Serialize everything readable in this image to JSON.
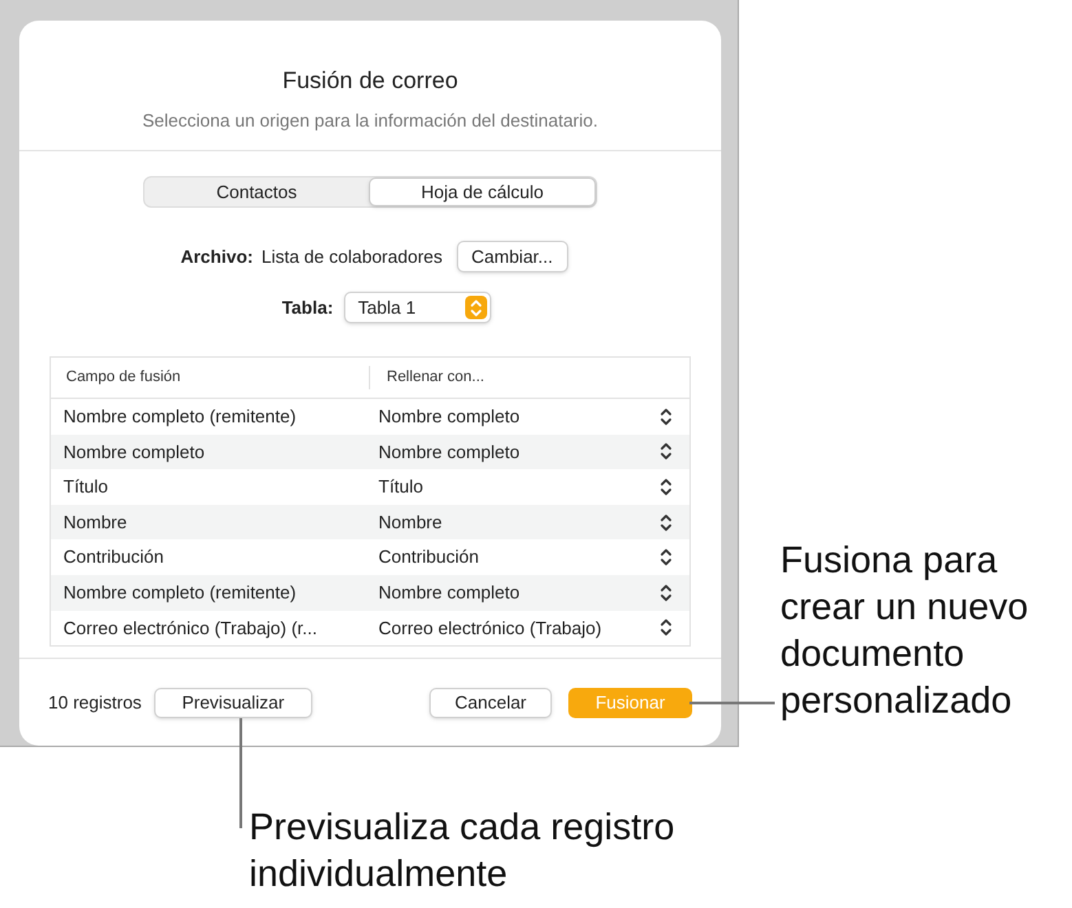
{
  "dialog": {
    "title": "Fusión de correo",
    "subtitle": "Selecciona un origen para la información del destinatario."
  },
  "source_tabs": [
    {
      "label": "Contactos",
      "selected": false
    },
    {
      "label": "Hoja de cálculo",
      "selected": true
    }
  ],
  "file": {
    "label": "Archivo:",
    "value": "Lista de colaboradores",
    "button": "Cambiar..."
  },
  "table_select": {
    "label": "Tabla:",
    "value": "Tabla 1"
  },
  "table": {
    "columns": [
      "Campo de fusión",
      "Rellenar con..."
    ],
    "rows": [
      [
        "Nombre completo (remitente)",
        "Nombre completo"
      ],
      [
        "Nombre completo",
        "Nombre completo"
      ],
      [
        "Título",
        "Título"
      ],
      [
        "Nombre",
        "Nombre"
      ],
      [
        "Contribución",
        "Contribución"
      ],
      [
        "Nombre completo (remitente)",
        "Nombre completo"
      ],
      [
        "Correo electrónico (Trabajo) (r...",
        "Correo electrónico (Trabajo)"
      ]
    ]
  },
  "footer": {
    "count": "10 registros",
    "preview_button": "Previsualizar",
    "cancel_button": "Cancelar",
    "merge_button": "Fusionar"
  },
  "callouts": {
    "merge": "Fusiona para crear un nuevo documento personalizado",
    "preview": "Previsualiza cada registro individualmente"
  }
}
